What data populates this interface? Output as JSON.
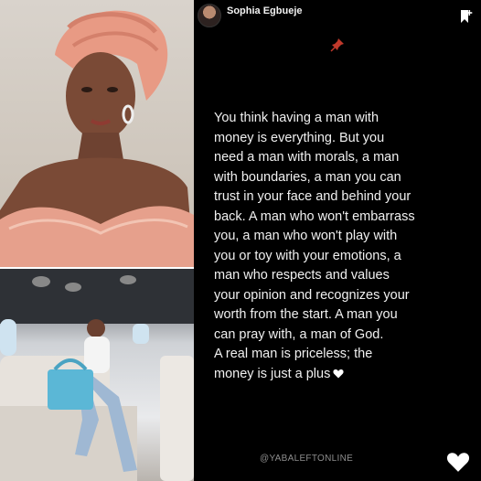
{
  "post": {
    "author": "Sophia Egbueje",
    "quote": "You think having a man with\nmoney is everything. But you\nneed a man with morals, a man\nwith boundaries, a man you can\ntrust in your face and behind your\nback. A man who won't embarrass\nyou, a man who won't play with\nyou or toy with your emotions, a\nman who respects and values\nyour opinion and recognizes your\nworth from the start. A man you\ncan pray with, a man of God.\nA real man is priceless; the\nmoney is just a plus",
    "watermark": "@YABALEFTONLINE"
  },
  "icons": {
    "bookmark": "bookmark-plus-icon",
    "pin": "pin-icon",
    "heart_inline": "heart-icon",
    "like": "like-heart-icon"
  },
  "colors": {
    "panel_background": "#000000",
    "text": "#f0f0f0",
    "pin": "#c0392b"
  }
}
